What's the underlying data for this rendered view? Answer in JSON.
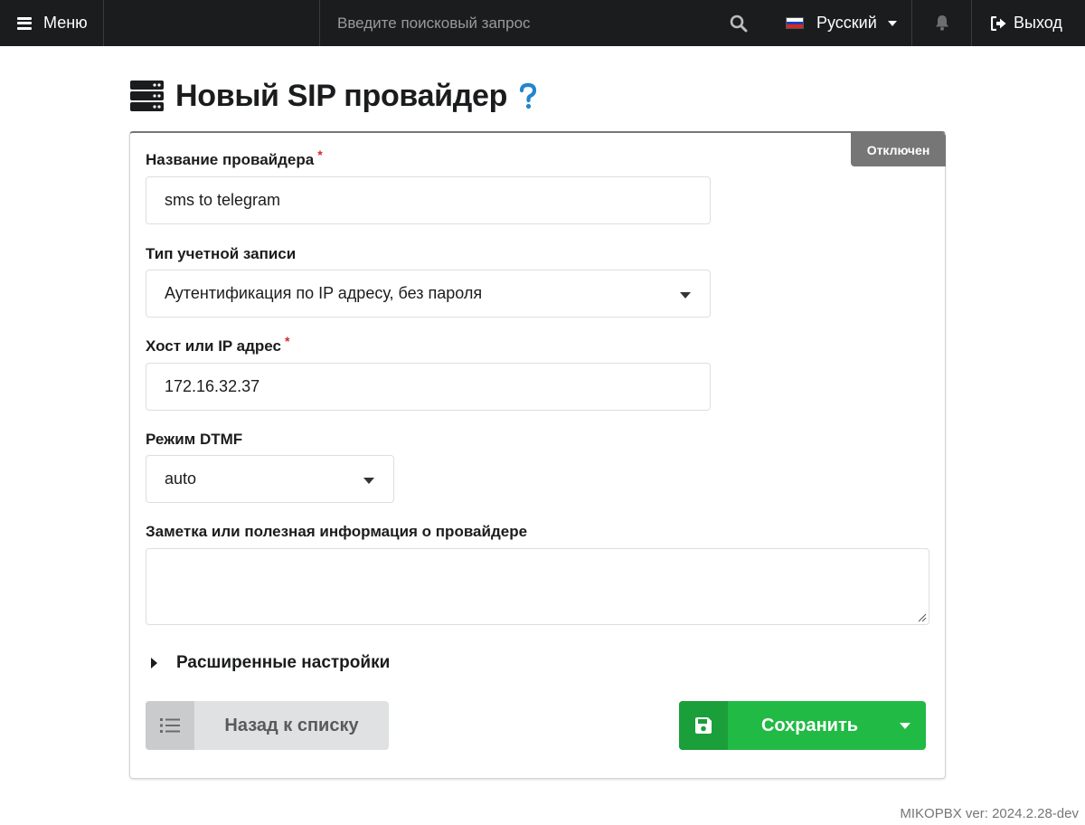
{
  "topbar": {
    "menu_label": "Меню",
    "search_placeholder": "Введите поисковый запрос",
    "language_label": "Русский",
    "logout_label": "Выход"
  },
  "page": {
    "title": "Новый SIP провайдер"
  },
  "form": {
    "status_badge": "Отключен",
    "provider_name": {
      "label": "Название провайдера",
      "required_mark": "*",
      "value": "sms to telegram"
    },
    "account_type": {
      "label": "Тип учетной записи",
      "selected": "Аутентификация по IP адресу, без пароля"
    },
    "host": {
      "label": "Хост или IP адрес",
      "required_mark": "*",
      "value": "172.16.32.37"
    },
    "dtmf_mode": {
      "label": "Режим DTMF",
      "selected": "auto"
    },
    "note": {
      "label": "Заметка или полезная информация о провайдере",
      "value": ""
    },
    "advanced_label": "Расширенные настройки",
    "back_button": "Назад к списку",
    "save_button": "Сохранить"
  },
  "footer": {
    "version": "MIKOPBX ver: 2024.2.28-dev"
  },
  "colors": {
    "topbar_bg": "#1b1c1d",
    "save_green": "#21ba45",
    "status_grey": "#767676",
    "required_red": "#db2828",
    "help_blue": "#2185d0"
  }
}
